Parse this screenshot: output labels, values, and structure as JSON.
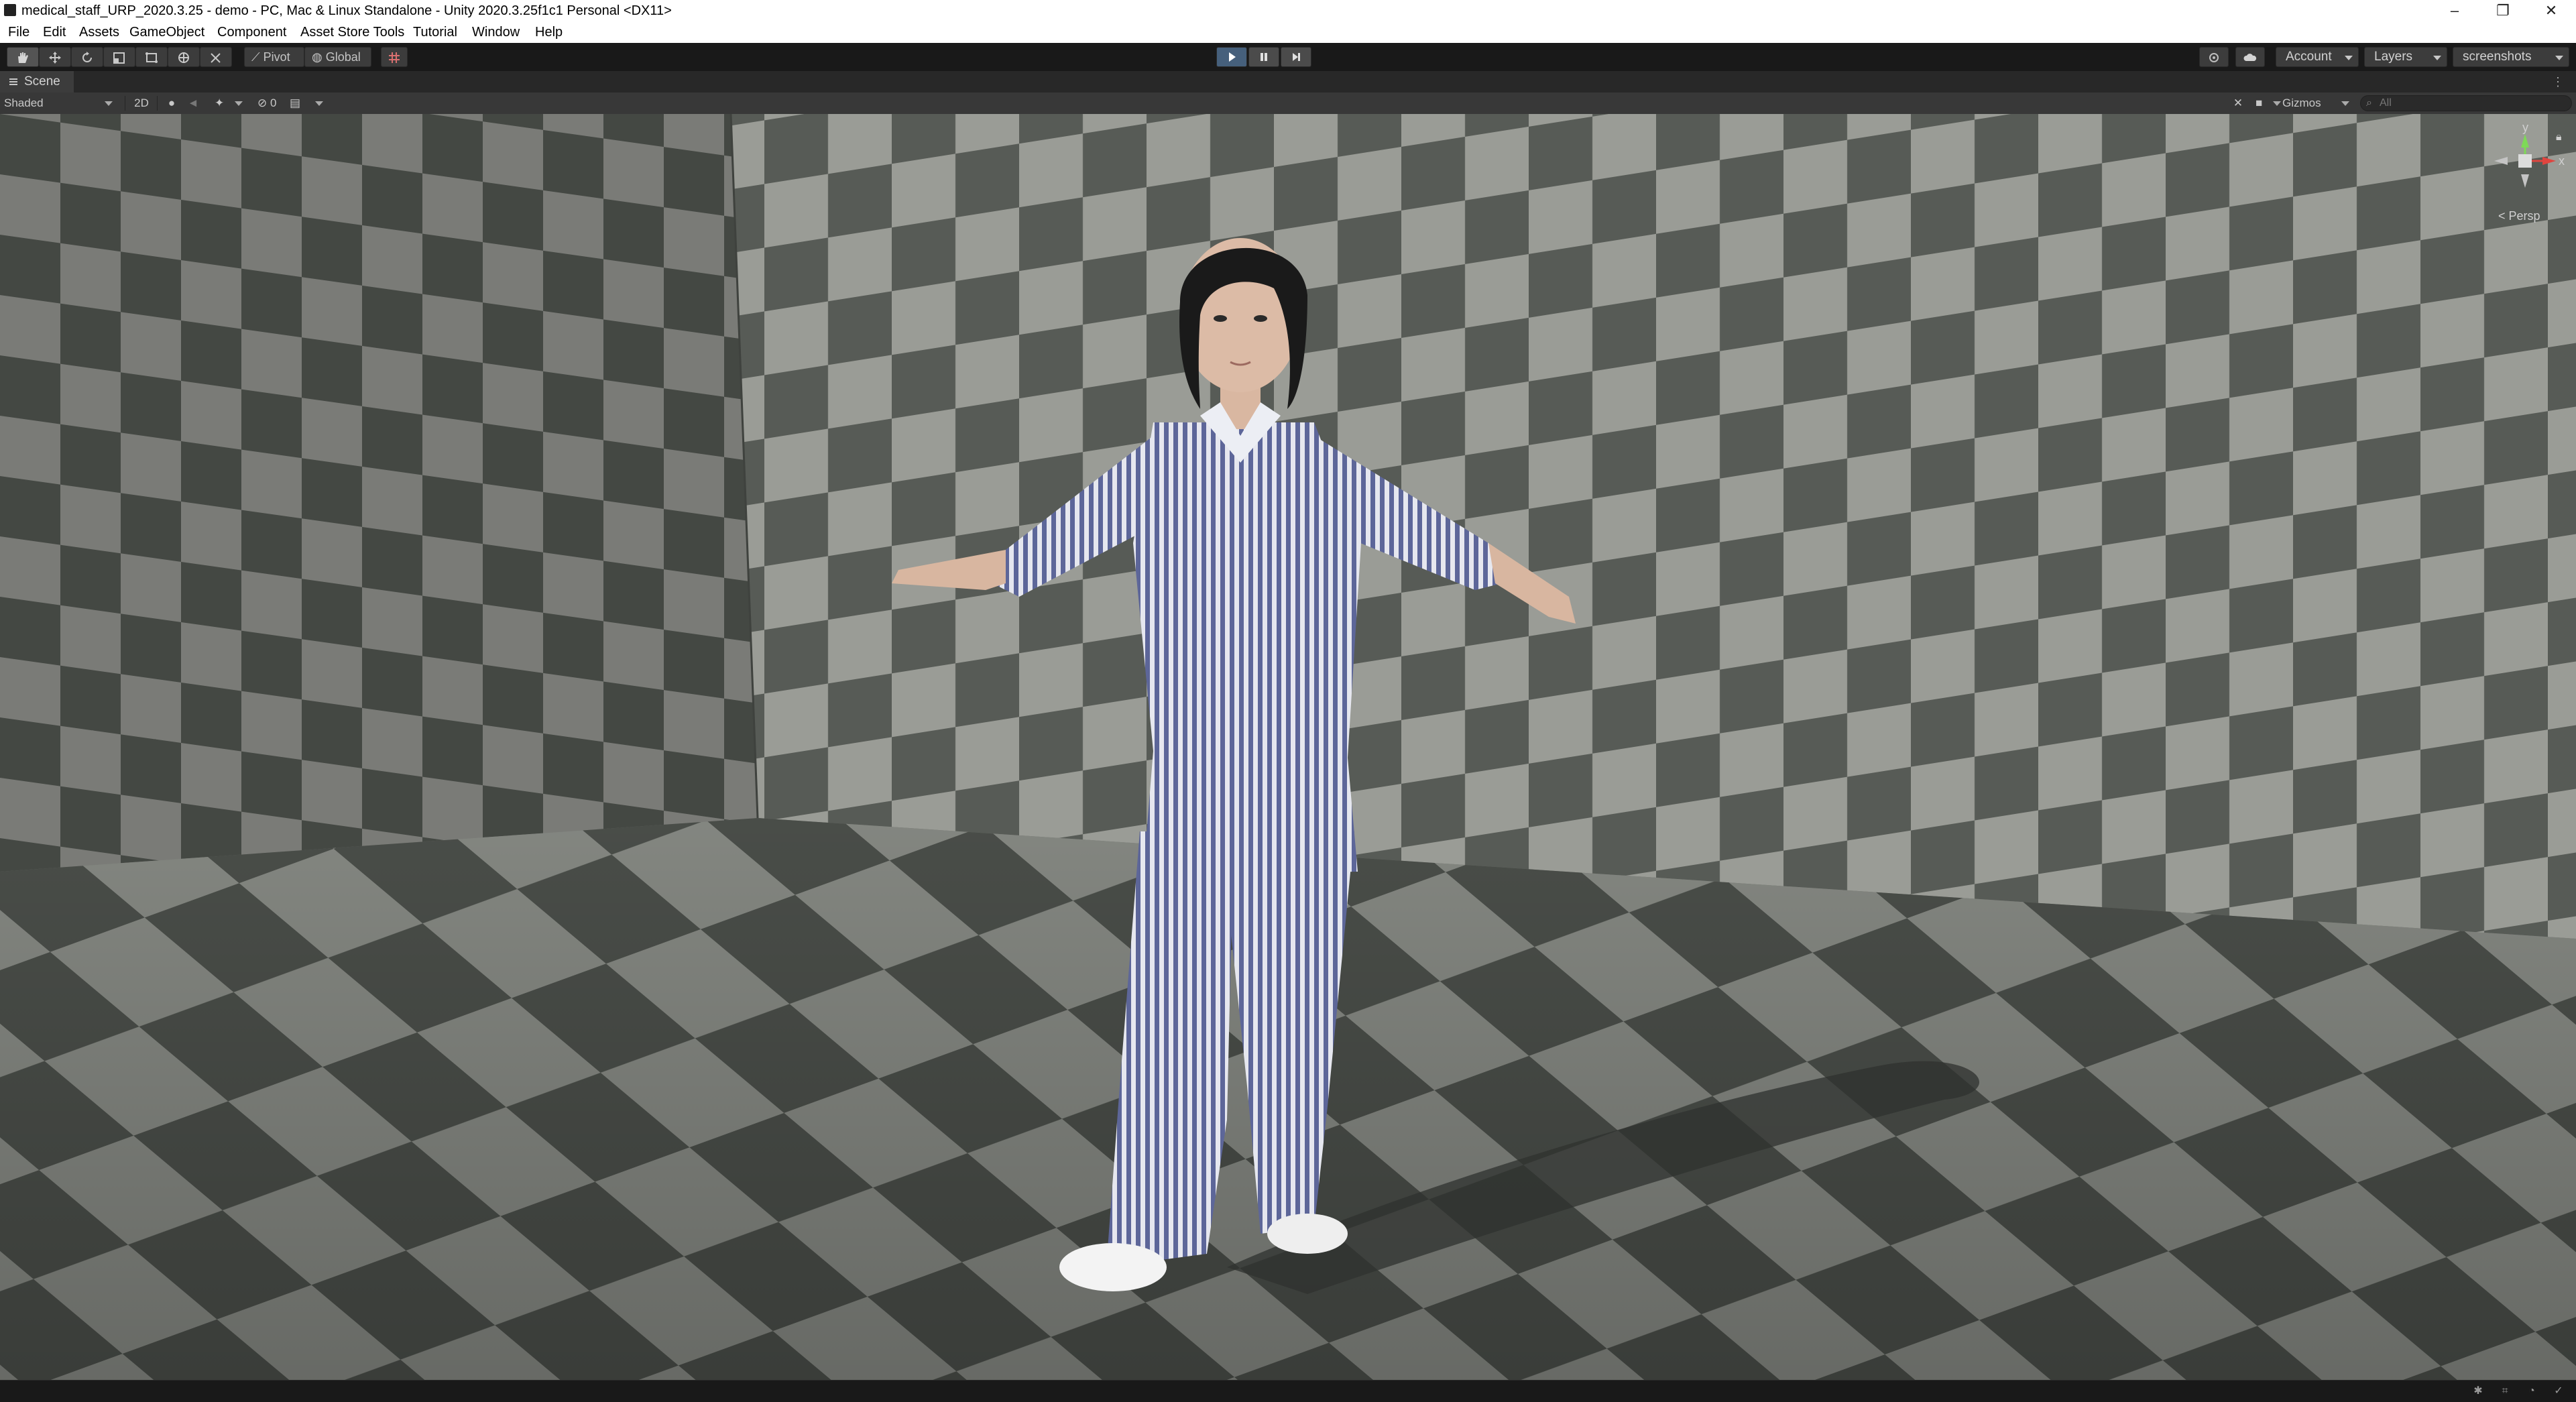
{
  "window": {
    "title": "medical_staff_URP_2020.3.25 - demo - PC, Mac & Linux Standalone - Unity 2020.3.25f1c1 Personal <DX11>",
    "minimize": "–",
    "restore": "❐",
    "close": "✕"
  },
  "menu": [
    "File",
    "Edit",
    "Assets",
    "GameObject",
    "Component",
    "Asset Store Tools",
    "Tutorial",
    "Window",
    "Help"
  ],
  "toolbar": {
    "pivot_label": "Pivot",
    "global_label": "Global",
    "account_label": "Account",
    "layers_label": "Layers",
    "layout_label": "screenshots",
    "play_state": "playing"
  },
  "scene_tab": {
    "label": "Scene",
    "kebab": "⋮"
  },
  "scene_toolbar": {
    "draw_mode": "Shaded",
    "mode_2d": "2D",
    "hidden_count": "0",
    "gizmos_label": "Gizmos",
    "search_placeholder": "All"
  },
  "orientation_gizmo": {
    "projection_label": "< Persp",
    "axis_y": "y",
    "axis_x": "x"
  },
  "colors": {
    "editor_bg": "#191919",
    "toolbar_btn": "#3c3c3c",
    "play_active": "#46607c",
    "floor_dark": "#4f534e",
    "floor_light": "#878a84",
    "pajama_stripe": "#5d6699"
  }
}
